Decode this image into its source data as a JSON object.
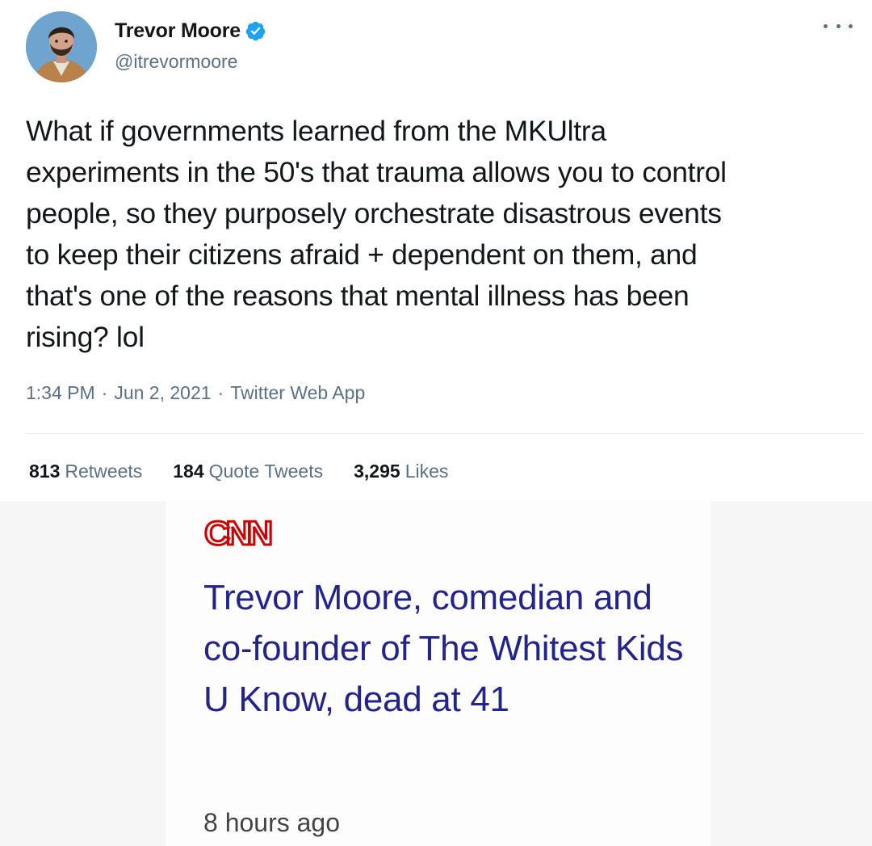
{
  "tweet": {
    "display_name": "Trevor Moore",
    "handle": "@itrevormoore",
    "verified": true,
    "more_icon": "more-horizontal-icon",
    "text": "What if governments learned from the MKUltra\nexperiments in the 50's that trauma allows you to control\npeople, so they purposely orchestrate disastrous events\nto keep their citizens afraid + dependent on them, and\nthat's one of the reasons that mental illness has been\nrising? lol",
    "meta": {
      "time": "1:34 PM",
      "separator1": "·",
      "date": "Jun 2, 2021",
      "separator2": "·",
      "source": "Twitter Web App"
    },
    "stats": [
      {
        "value": "813",
        "label": "Retweets"
      },
      {
        "value": "184",
        "label": "Quote Tweets"
      },
      {
        "value": "3,295",
        "label": "Likes"
      }
    ],
    "colors": {
      "verified": "#1da1f2",
      "secondary_text": "#5b7083"
    }
  },
  "cnn": {
    "logo": "CNN",
    "headline": "Trevor Moore, comedian and co-founder of The Whitest Kids U Know, dead at 41",
    "time_ago": "8 hours ago",
    "colors": {
      "logo": "#cc0000",
      "headline": "#23238c"
    }
  }
}
